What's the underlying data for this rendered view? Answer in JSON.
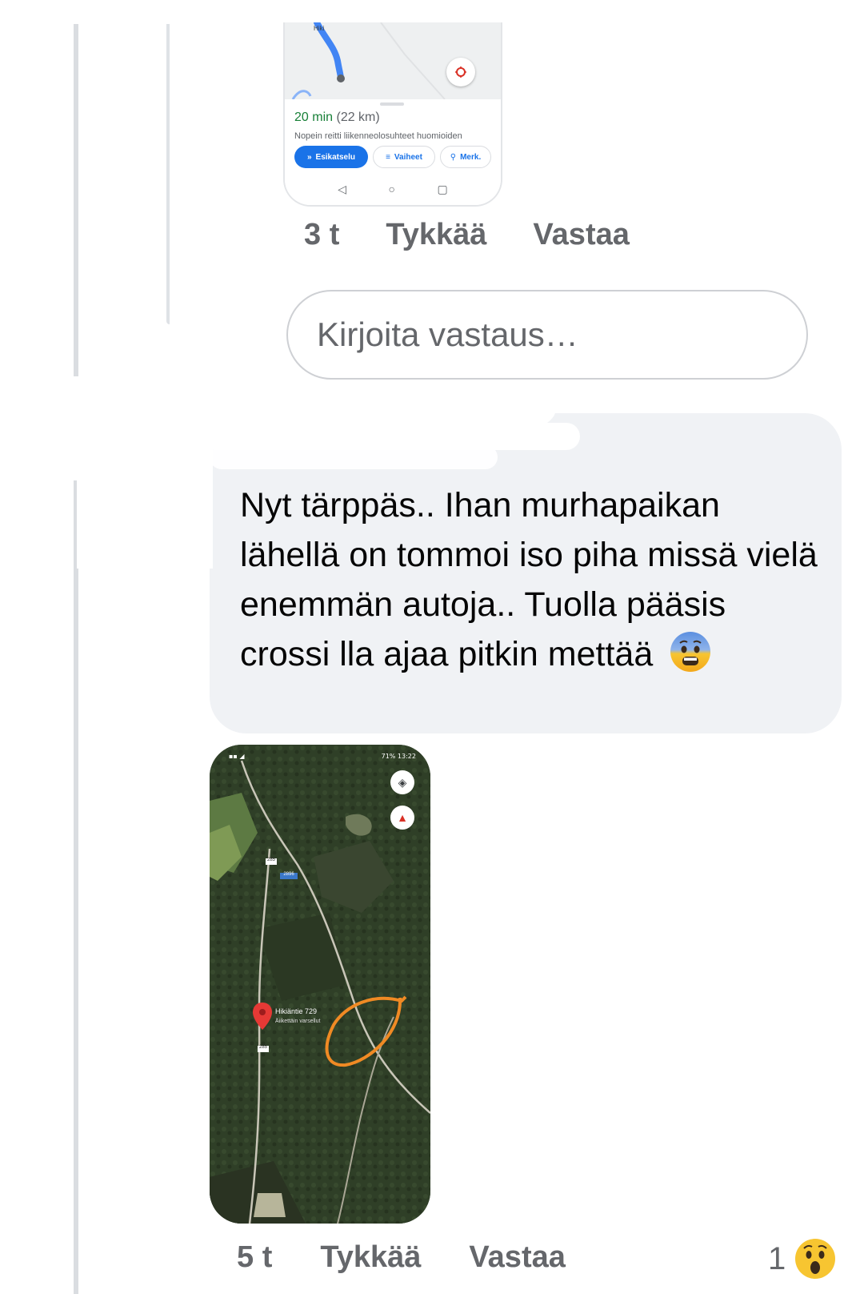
{
  "top_screenshot": {
    "eta_minutes": "20 min",
    "eta_distance": "(22 km)",
    "route_description": "Nopein reitti liikenneolosuhteet huomioiden",
    "buttons": [
      "Esikatselu",
      "Vaiheet",
      "Merk."
    ]
  },
  "reply1": {
    "time": "3 t",
    "like": "Tykkää",
    "reply": "Vastaa"
  },
  "reply_input": {
    "placeholder": "Kirjoita vastaus…"
  },
  "comment": {
    "text": "Nyt tärppäs.. Ihan murhapaikan lähellä on tommoi iso piha missä vielä enemmän autoja.. Tuolla pääsis crossi lla ajaa pitkin mettää",
    "emoji": "anxious-face-emoji"
  },
  "map_screenshot": {
    "status_left": "",
    "status_right": "71%  13:22",
    "pin_label": "Hikiäntie 729",
    "pin_sublabel": "Äiikettäin varsellut",
    "road_label_1": "285",
    "road_label_2": "2896",
    "road_label_3": "285"
  },
  "reply2": {
    "time": "5 t",
    "like": "Tykkää",
    "reply": "Vastaa",
    "reaction_count": "1",
    "reaction_emoji": "wow-emoji"
  },
  "colors": {
    "meta_gray": "#65676b",
    "bubble_bg": "#f0f2f5",
    "maps_blue": "#1a73e8",
    "eta_green": "#188038",
    "circle_orange": "#f08a24"
  }
}
